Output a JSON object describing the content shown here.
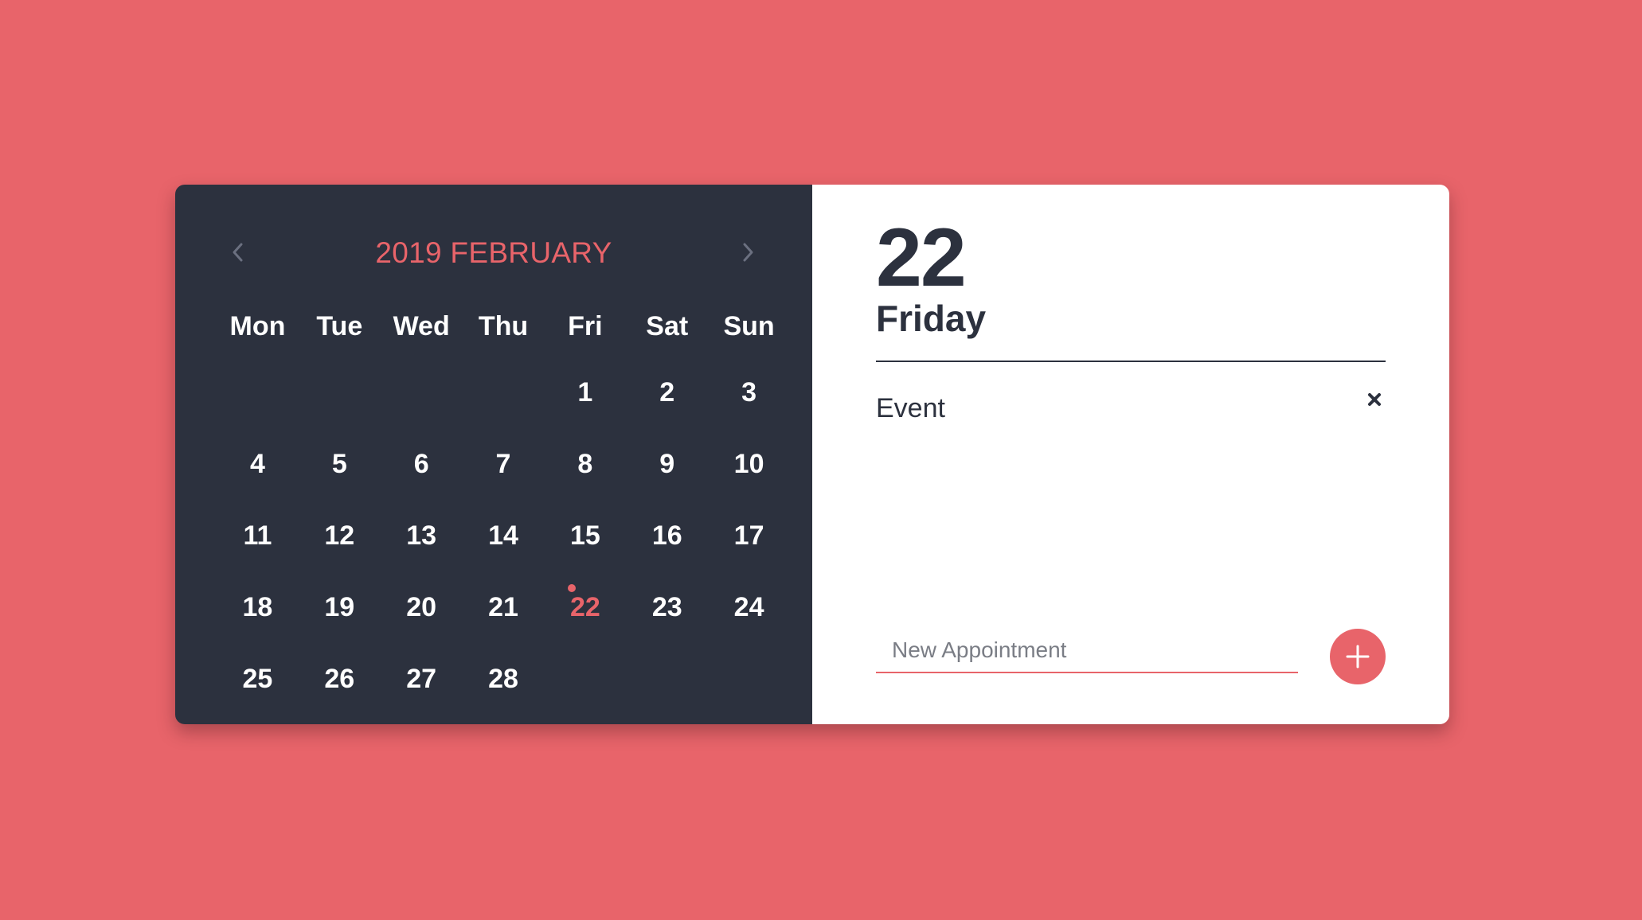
{
  "colors": {
    "background": "#e8646a",
    "calendar_panel": "#2c313e",
    "detail_panel": "#ffffff",
    "accent": "#e8646a",
    "text_dark": "#2c313e",
    "text_light": "#ffffff"
  },
  "calendar": {
    "title": "2019 FEBRUARY",
    "prev_icon": "chevron-left-icon",
    "next_icon": "chevron-right-icon",
    "weekdays": [
      "Mon",
      "Tue",
      "Wed",
      "Thu",
      "Fri",
      "Sat",
      "Sun"
    ],
    "weeks": [
      [
        "",
        "",
        "",
        "",
        "1",
        "2",
        "3"
      ],
      [
        "4",
        "5",
        "6",
        "7",
        "8",
        "9",
        "10"
      ],
      [
        "11",
        "12",
        "13",
        "14",
        "15",
        "16",
        "17"
      ],
      [
        "18",
        "19",
        "20",
        "21",
        "22",
        "23",
        "24"
      ],
      [
        "25",
        "26",
        "27",
        "28",
        "",
        "",
        ""
      ]
    ],
    "selected_day": "22",
    "days_with_events": [
      "22"
    ]
  },
  "detail": {
    "day_number": "22",
    "weekday": "Friday",
    "events": [
      {
        "text": "Event",
        "remove_icon": "close-icon"
      }
    ],
    "new_appointment_placeholder": "New Appointment",
    "new_appointment_value": "",
    "add_icon": "plus-icon"
  }
}
